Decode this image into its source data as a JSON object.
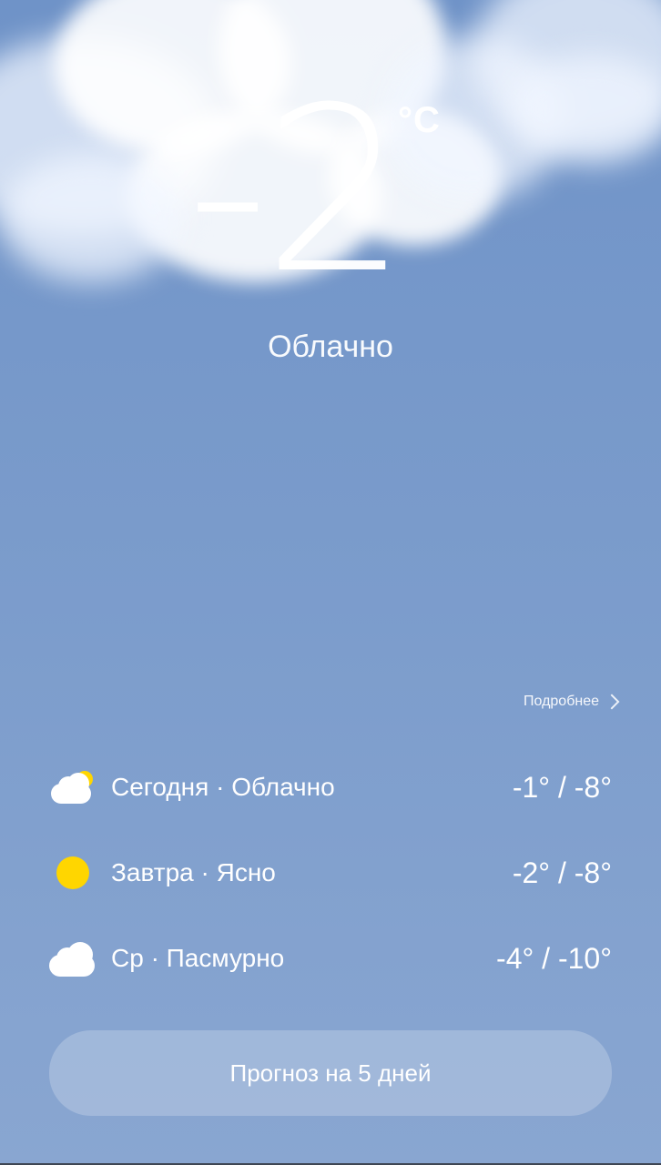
{
  "current": {
    "temperature": "-2",
    "unit": "°C",
    "condition": "Облачно"
  },
  "details_link": {
    "label": "Подробнее",
    "icon": "chevron-right-icon"
  },
  "forecast": [
    {
      "label": "Сегодня · Облачно",
      "temps": "-1° / -8°",
      "icon": "partly-cloudy-icon"
    },
    {
      "label": "Завтра · Ясно",
      "temps": "-2° / -8°",
      "icon": "sun-icon"
    },
    {
      "label": "Ср · Пасмурно",
      "temps": "-4° / -10°",
      "icon": "cloud-icon"
    }
  ],
  "forecast_button": {
    "label": "Прогноз на 5 дней"
  },
  "colors": {
    "sun": "#ffd600",
    "sky": "#7a9bcb"
  }
}
